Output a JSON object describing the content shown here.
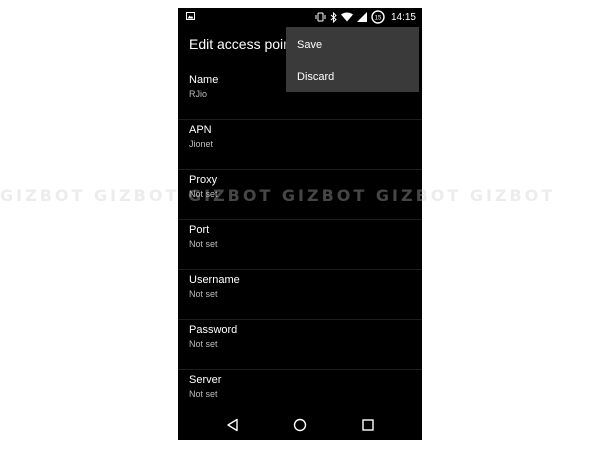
{
  "status_bar": {
    "time": "14:15",
    "battery_level": "15",
    "icons": [
      "image-icon",
      "vibrate-icon",
      "bluetooth-icon",
      "wifi-icon",
      "signal-icon",
      "battery-icon"
    ]
  },
  "header": {
    "title": "Edit access poin"
  },
  "overflow_menu": {
    "items": [
      {
        "label": "Save"
      },
      {
        "label": "Discard"
      }
    ]
  },
  "settings": {
    "items": [
      {
        "label": "Name",
        "value": "RJio"
      },
      {
        "label": "APN",
        "value": "Jionet"
      },
      {
        "label": "Proxy",
        "value": "Not set"
      },
      {
        "label": "Port",
        "value": "Not set"
      },
      {
        "label": "Username",
        "value": "Not set"
      },
      {
        "label": "Password",
        "value": "Not set"
      },
      {
        "label": "Server",
        "value": "Not set"
      }
    ]
  },
  "watermark": {
    "text": "GIZBOT GIZBOT GIZBOT GIZBOT GIZBOT GIZBOT"
  },
  "navigation": {
    "icons": [
      "back-icon",
      "home-icon",
      "recents-icon"
    ]
  }
}
